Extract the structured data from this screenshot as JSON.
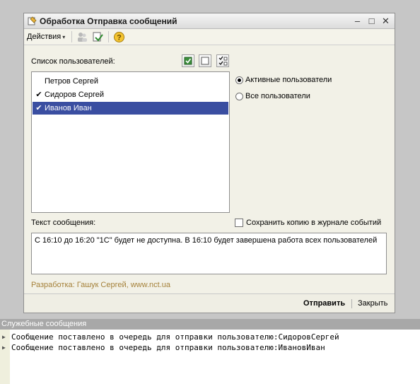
{
  "window": {
    "title": "Обработка  Отправка сообщений",
    "controls": {
      "minimize": "–",
      "maximize": "□",
      "close": "✕"
    }
  },
  "toolbar": {
    "actions_label": "Действия",
    "actions_caret": "▾"
  },
  "users": {
    "list_label": "Список пользователей:",
    "rows": [
      {
        "name": "Петров Сергей",
        "checked": "",
        "selected": false
      },
      {
        "name": "Сидоров Сергей",
        "checked": "✔",
        "selected": false
      },
      {
        "name": "Иванов Иван",
        "checked": "✔",
        "selected": true
      }
    ]
  },
  "filter": {
    "active_label": "Активные пользователи",
    "all_label": "Все пользователи",
    "selected": "active"
  },
  "message": {
    "label": "Текст сообщения:",
    "text": "С 16:10 до 16:20 \"1С\" будет не доступна. В 16:10 будет завершена работа всех пользователей",
    "save_copy_label": "Сохранить копию в журнале событий"
  },
  "credit": "Разработка: Гашук Сергей, www.nct.ua",
  "footer": {
    "send_label": "Отправить",
    "close_label": "Закрыть"
  },
  "service_messages": {
    "header": "Служебные сообщения",
    "lines": [
      "Сообщение поставлено в очередь для отправки пользователю:СидоровСергей",
      "Сообщение поставлено в очередь для отправки пользователю:ИвановИван"
    ]
  },
  "colors": {
    "selection": "#3a4ea1",
    "credit": "#a5813a",
    "window_bg": "#f2f1e7"
  }
}
